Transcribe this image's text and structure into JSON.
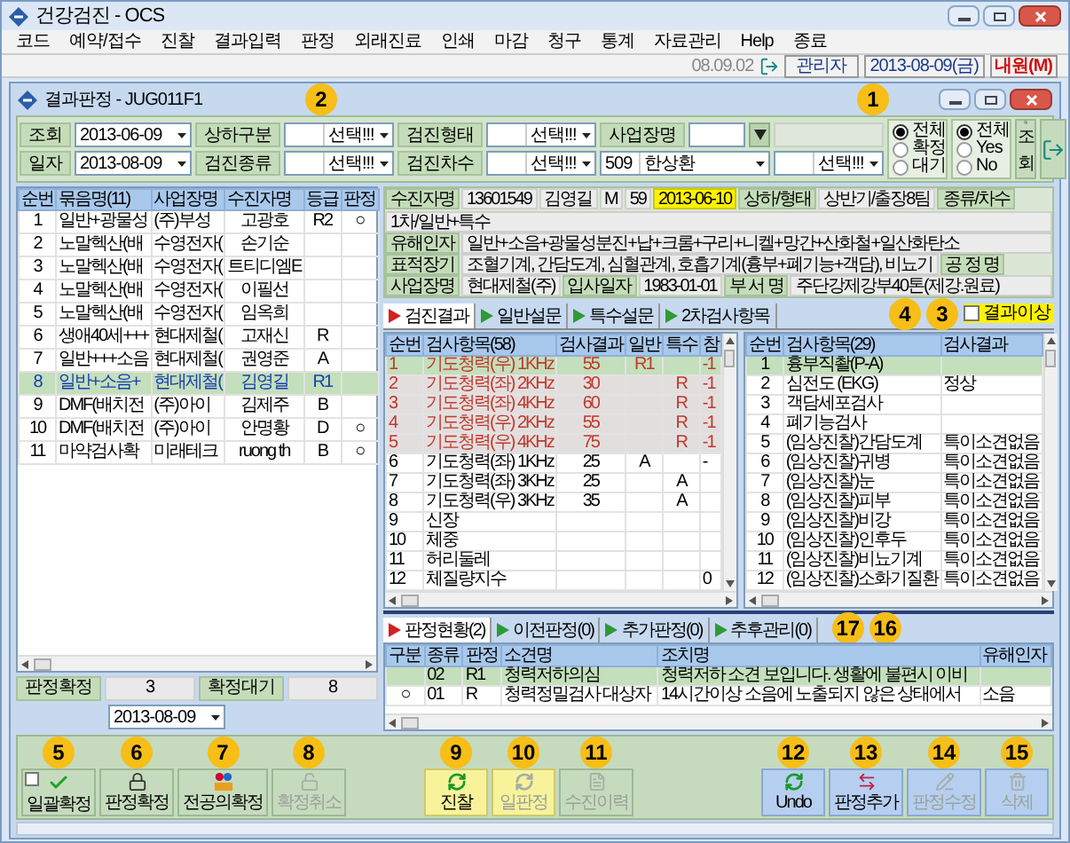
{
  "app_window": {
    "title": "건강검진 - OCS"
  },
  "menu": [
    "코드",
    "예약/접수",
    "진찰",
    "결과입력",
    "판정",
    "외래진료",
    "인쇄",
    "마감",
    "청구",
    "통계",
    "자료관리",
    "Help",
    "종료"
  ],
  "toolbar": {
    "version": "08.09.02",
    "user": "관리자",
    "date": "2013-08-09(금)",
    "visit": "내원(M)"
  },
  "window": {
    "title": "결과판정 - JUG011F1"
  },
  "filters": {
    "rows": [
      [
        {
          "kind": "date",
          "label": "조회",
          "value": "2013-06-09"
        },
        {
          "kind": "select",
          "label": "상하구분",
          "value": "선택!!!"
        },
        {
          "kind": "select",
          "label": "검진형태",
          "value": "선택!!!"
        },
        {
          "kind": "lookup",
          "label": "사업장명"
        }
      ],
      [
        {
          "kind": "date",
          "label": "일자",
          "value": "2013-08-09"
        },
        {
          "kind": "select",
          "label": "검진종류",
          "value": "선택!!!"
        },
        {
          "kind": "select",
          "label": "검진차수",
          "value": "선택!!!"
        },
        {
          "kind": "select",
          "code": "509",
          "value": "한상환"
        },
        {
          "kind": "select",
          "value": "선택!!!"
        }
      ]
    ],
    "status_options": [
      {
        "label": "전체",
        "selected": true
      },
      {
        "label": "확정",
        "selected": false
      },
      {
        "label": "대기",
        "selected": false
      }
    ],
    "yes_no_options": [
      {
        "label": "전체",
        "selected": true
      },
      {
        "label": "Yes",
        "selected": false
      },
      {
        "label": "No",
        "selected": false
      }
    ],
    "search_button": "조회"
  },
  "patient_list": {
    "columns": [
      "순번",
      "묶음명(11)",
      "사업장명",
      "수진자명",
      "등급",
      "판정"
    ],
    "rows": [
      {
        "selected": false,
        "cells": [
          "1",
          "일반+광물성",
          "(주)부성",
          "고광호",
          "R2",
          "○"
        ]
      },
      {
        "selected": false,
        "cells": [
          "2",
          "노말헥산(배",
          "수영전자(",
          "손기순",
          null,
          null
        ]
      },
      {
        "selected": false,
        "cells": [
          "3",
          "노말헥산(배",
          "수영전자(",
          "트티디엠E",
          null,
          null
        ]
      },
      {
        "selected": false,
        "cells": [
          "4",
          "노말헥산(배",
          "수영전자(",
          "이필선",
          null,
          null
        ]
      },
      {
        "selected": false,
        "cells": [
          "5",
          "노말헥산(배",
          "수영전자(",
          "임옥희",
          null,
          null
        ]
      },
      {
        "selected": false,
        "cells": [
          "6",
          "생애40세+++",
          "현대제철(",
          "고재신",
          "R",
          null
        ]
      },
      {
        "selected": false,
        "cells": [
          "7",
          "일반+++소음",
          "현대제철(",
          "권영준",
          "A",
          null
        ]
      },
      {
        "selected": true,
        "cells": [
          "8",
          "일반+소음+",
          "현대제철(",
          "김영길",
          "R1",
          null
        ]
      },
      {
        "selected": false,
        "cells": [
          "9",
          "DMF(배치전",
          "(주)아이",
          "김제주",
          "B",
          null
        ]
      },
      {
        "selected": false,
        "cells": [
          "10",
          "DMF(배치전",
          "(주)아이",
          "안명황",
          "D",
          "○"
        ]
      },
      {
        "selected": false,
        "cells": [
          "11",
          "마약검사확",
          "미래테크",
          "ruong th",
          "B",
          "○"
        ]
      }
    ]
  },
  "summary": [
    {
      "label": "판정확정",
      "value": "3"
    },
    {
      "label": "확정대기",
      "value": "8"
    }
  ],
  "judgment_date": "2013-08-09",
  "patient_info": [
    [
      {
        "kind": "label",
        "text": "수진자명"
      },
      {
        "kind": "value",
        "text": "13601549"
      },
      {
        "kind": "value",
        "text": "김영길"
      },
      {
        "kind": "value",
        "text": "M"
      },
      {
        "kind": "value",
        "text": "59"
      },
      {
        "kind": "highlight",
        "text": "2013-06-10"
      },
      {
        "kind": "label",
        "text": "상하/형태"
      },
      {
        "kind": "value",
        "text": "상반기/출장8팀"
      },
      {
        "kind": "label",
        "text": "종류/차수"
      },
      {
        "kind": "value",
        "text": "1차/일반+특수"
      }
    ],
    [
      {
        "kind": "label",
        "text": "유해인자"
      },
      {
        "kind": "value",
        "text": "일반+소음+광물성분진+납+크롬+구리+니켈+망간+산화철+일산화탄소"
      }
    ],
    [
      {
        "kind": "label",
        "text": "표적장기"
      },
      {
        "kind": "value",
        "text": "조혈기계, 간담도계, 심혈관계, 호흡기계(흉부+폐기능+객담), 비뇨기"
      },
      {
        "kind": "label",
        "text": "공 정 명"
      }
    ],
    [
      {
        "kind": "label",
        "text": "사업장명"
      },
      {
        "kind": "value",
        "text": "현대제철(주)"
      },
      {
        "kind": "label",
        "text": "입사일자"
      },
      {
        "kind": "value",
        "text": "1983-01-01"
      },
      {
        "kind": "label",
        "text": "부 서 명"
      },
      {
        "kind": "value",
        "text": "주단강제강부40톤(제강.원료)"
      }
    ]
  ],
  "result_tabs": [
    {
      "label": "검진결과",
      "selected": true
    },
    {
      "label": "일반설문",
      "selected": false
    },
    {
      "label": "특수설문",
      "selected": false
    },
    {
      "label": "2차검사항목",
      "selected": false
    }
  ],
  "abnormal_filter": {
    "label": "결과이상",
    "checked": false
  },
  "test_results": {
    "columns": [
      "순번",
      "검사항목(58)",
      "검사결과",
      "일반",
      "특수",
      "참"
    ],
    "rows": [
      {
        "selected": true,
        "abnormal": true,
        "cells": [
          "1",
          "기도청력(우) 1KHz",
          "55",
          "R1",
          null,
          "-1"
        ]
      },
      {
        "selected": false,
        "abnormal": true,
        "cells": [
          "2",
          "기도청력(좌) 2KHz",
          "30",
          null,
          "R",
          "-1"
        ]
      },
      {
        "selected": false,
        "abnormal": true,
        "cells": [
          "3",
          "기도청력(좌) 4KHz",
          "60",
          null,
          "R",
          "-1"
        ]
      },
      {
        "selected": false,
        "abnormal": true,
        "cells": [
          "4",
          "기도청력(우) 2KHz",
          "55",
          null,
          "R",
          "-1"
        ]
      },
      {
        "selected": false,
        "abnormal": true,
        "cells": [
          "5",
          "기도청력(우) 4KHz",
          "75",
          null,
          "R",
          "-1"
        ]
      },
      {
        "selected": false,
        "abnormal": false,
        "cells": [
          "6",
          "기도청력(좌) 1KHz",
          "25",
          "A",
          null,
          "-"
        ]
      },
      {
        "selected": false,
        "abnormal": false,
        "cells": [
          "7",
          "기도청력(좌) 3KHz",
          "25",
          null,
          "A",
          null
        ]
      },
      {
        "selected": false,
        "abnormal": false,
        "cells": [
          "8",
          "기도청력(우) 3KHz",
          "35",
          null,
          "A",
          null
        ]
      },
      {
        "selected": false,
        "abnormal": false,
        "cells": [
          "9",
          "신장",
          null,
          null,
          null,
          null
        ]
      },
      {
        "selected": false,
        "abnormal": false,
        "cells": [
          "10",
          "체중",
          null,
          null,
          null,
          null
        ]
      },
      {
        "selected": false,
        "abnormal": false,
        "cells": [
          "11",
          "허리둘레",
          null,
          null,
          null,
          null
        ]
      },
      {
        "selected": false,
        "abnormal": false,
        "cells": [
          "12",
          "체질량지수",
          null,
          null,
          null,
          "0"
        ]
      }
    ]
  },
  "exam_items": {
    "columns": [
      "순번",
      "검사항목(29)",
      "검사결과"
    ],
    "rows": [
      {
        "selected": true,
        "cells": [
          "1",
          "흉부직촬(P-A)",
          null
        ]
      },
      {
        "selected": false,
        "cells": [
          "2",
          "심전도 (EKG)",
          "정상"
        ]
      },
      {
        "selected": false,
        "cells": [
          "3",
          "객담세포검사",
          null
        ]
      },
      {
        "selected": false,
        "cells": [
          "4",
          "폐기능검사",
          null
        ]
      },
      {
        "selected": false,
        "cells": [
          "5",
          "(임상진찰)간담도계",
          "특이소견없음"
        ]
      },
      {
        "selected": false,
        "cells": [
          "6",
          "(임상진찰)귀병",
          "특이소견없음"
        ]
      },
      {
        "selected": false,
        "cells": [
          "7",
          "(임상진찰)눈",
          "특이소견없음"
        ]
      },
      {
        "selected": false,
        "cells": [
          "8",
          "(임상진찰)피부",
          "특이소견없음"
        ]
      },
      {
        "selected": false,
        "cells": [
          "9",
          "(임상진찰)비강",
          "특이소견없음"
        ]
      },
      {
        "selected": false,
        "cells": [
          "10",
          "(임상진찰)인후두",
          "특이소견없음"
        ]
      },
      {
        "selected": false,
        "cells": [
          "11",
          "(임상진찰)비뇨기계",
          "특이소견없음"
        ]
      },
      {
        "selected": false,
        "cells": [
          "12",
          "(임상진찰)소화기질환",
          "특이소견없음"
        ]
      }
    ]
  },
  "judgment_tabs": [
    {
      "label": "판정현황(2)",
      "selected": true
    },
    {
      "label": "이전판정(0)",
      "selected": false
    },
    {
      "label": "추가판정(0)",
      "selected": false
    },
    {
      "label": "추후관리(0)",
      "selected": false
    }
  ],
  "judgments": {
    "columns": [
      "구분",
      "종류",
      "판정",
      "소견명",
      "조치명",
      "유해인자"
    ],
    "rows": [
      {
        "selected": true,
        "cells": [
          null,
          "02",
          "R1",
          "청력저하의심",
          "청력저하 소견 보입니다. 생활에 불편시 이비",
          null
        ]
      },
      {
        "selected": false,
        "cells": [
          "○",
          "01",
          "R",
          "청력정밀검사 대상자",
          "14시간이상 소음에 노출되지 않은 상태에서",
          "소음"
        ]
      }
    ]
  },
  "buttons": {
    "left": [
      {
        "label": "일괄확정",
        "kind": "green",
        "disabled": false,
        "checkbox": {
          "checked": false
        }
      },
      {
        "label": "판정확정",
        "kind": "green",
        "disabled": false
      },
      {
        "label": "전공의확정",
        "kind": "green",
        "disabled": false
      },
      {
        "label": "확정취소",
        "kind": "green",
        "disabled": true
      }
    ],
    "center": [
      {
        "label": "진찰",
        "kind": "yellow",
        "disabled": false
      },
      {
        "label": "일판정",
        "kind": "yellow",
        "disabled": true
      },
      {
        "label": "수진이력",
        "kind": "green",
        "disabled": true
      }
    ],
    "right": [
      {
        "label": "Undo",
        "kind": "blue",
        "disabled": false
      },
      {
        "label": "판정추가",
        "kind": "blue",
        "disabled": false
      },
      {
        "label": "판정수정",
        "kind": "blue",
        "disabled": true
      },
      {
        "label": "삭제",
        "kind": "blue",
        "disabled": true
      }
    ]
  },
  "callouts": [
    "1",
    "2",
    "3",
    "4",
    "5",
    "6",
    "7",
    "8",
    "9",
    "10",
    "11",
    "12",
    "13",
    "14",
    "15",
    "16",
    "17"
  ]
}
